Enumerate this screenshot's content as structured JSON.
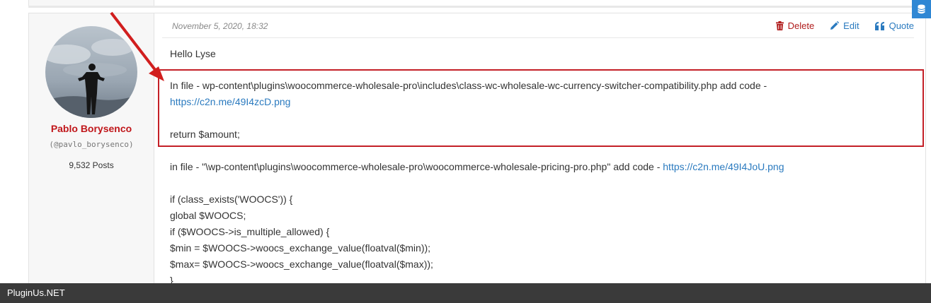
{
  "post": {
    "date": "November 5, 2020, 18:32",
    "actions": {
      "delete_label": "Delete",
      "edit_label": "Edit",
      "quote_label": "Quote"
    },
    "author": {
      "name": "Pablo Borysenco",
      "handle": "(@pavlo_borysenco)",
      "posts": "9,532 Posts"
    },
    "greeting": "Hello Lyse",
    "highlight": {
      "line1": "In  file - wp-content\\plugins\\woocommerce-wholesale-pro\\includes\\class-wc-wholesale-wc-currency-switcher-compatibility.php  add  code -",
      "link1": "https://c2n.me/49I4zcD.png",
      "line2": "return $amount;"
    },
    "line3_text": "in file  - \"\\wp-content\\plugins\\woocommerce-wholesale-pro\\woocommerce-wholesale-pricing-pro.php\"  add  code - ",
    "link2": "https://c2n.me/49I4JoU.png",
    "code_lines": [
      "if (class_exists('WOOCS')) {",
      "global $WOOCS;",
      "if ($WOOCS->is_multiple_allowed) {",
      "$min = $WOOCS->woocs_exchange_value(floatval($min));",
      "$max= $WOOCS->woocs_exchange_value(floatval($max));",
      "}"
    ]
  },
  "footer": {
    "site_name": "PluginUs.NET"
  },
  "colors": {
    "accent_red": "#c42027",
    "link_blue": "#2a7abf",
    "author_red": "#c0161a"
  },
  "icons": [
    "trash-icon",
    "pencil-icon",
    "quote-icon",
    "database-icon"
  ]
}
